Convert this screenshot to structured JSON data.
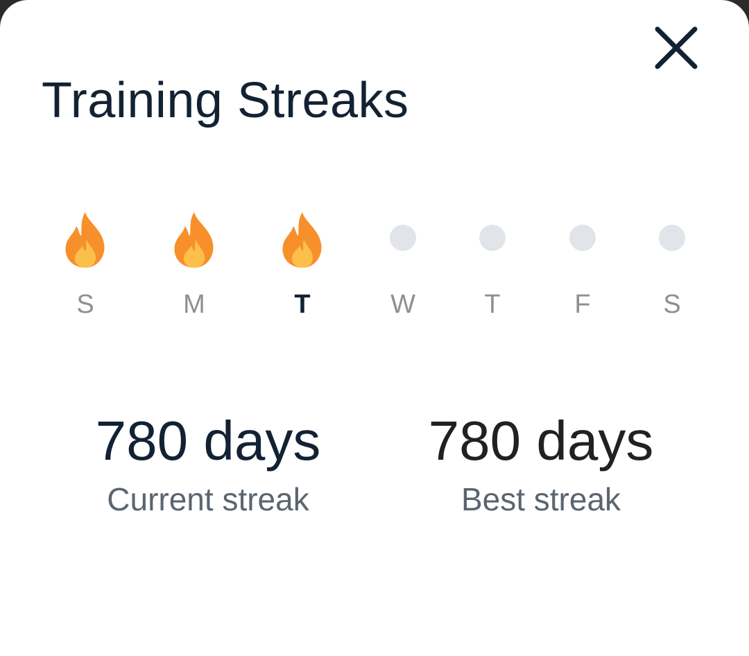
{
  "dialog": {
    "title": "Training Streaks",
    "close_icon": "close-icon"
  },
  "week": {
    "days": [
      {
        "label": "S",
        "completed": true,
        "today": false
      },
      {
        "label": "M",
        "completed": true,
        "today": false
      },
      {
        "label": "T",
        "completed": true,
        "today": true
      },
      {
        "label": "W",
        "completed": false,
        "today": false
      },
      {
        "label": "T",
        "completed": false,
        "today": false
      },
      {
        "label": "F",
        "completed": false,
        "today": false
      },
      {
        "label": "S",
        "completed": false,
        "today": false
      }
    ],
    "completed_icon": "flame-icon",
    "pending_icon": "empty-dot-icon"
  },
  "stats": {
    "current": {
      "value": "780 days",
      "caption": "Current streak"
    },
    "best": {
      "value": "780 days",
      "caption": "Best streak"
    }
  },
  "colors": {
    "title": "#122233",
    "flame_outer": "#f7902a",
    "flame_inner": "#fcc04a",
    "pending_dot": "#e1e4e8",
    "day_label": "#8f8f8f",
    "caption": "#5a6570"
  }
}
